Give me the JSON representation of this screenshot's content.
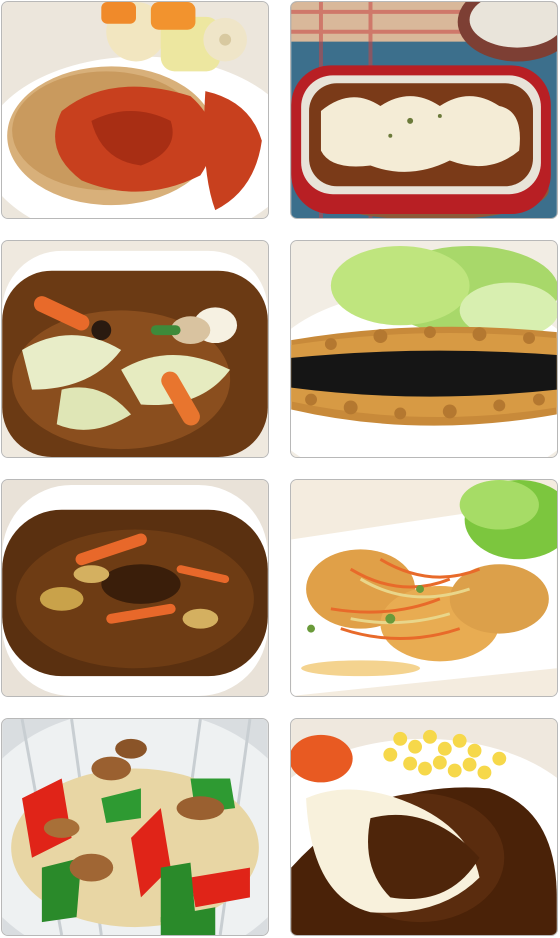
{
  "photos": [
    {
      "depicts": "chicken-tomato-sauce-icon"
    },
    {
      "depicts": "doria-gratin-icon"
    },
    {
      "depicts": "chop-suey-soup-icon"
    },
    {
      "depicts": "nori-katsu-icon"
    },
    {
      "depicts": "curry-soup-icon"
    },
    {
      "depicts": "fried-fish-nanban-icon"
    },
    {
      "depicts": "pork-vegetable-stirfry-icon"
    },
    {
      "depicts": "hamburg-steak-demiglace-icon"
    }
  ],
  "colors": {
    "tile_border": "#b8b8b8",
    "tomato_sauce": "#c8401e",
    "gratin_dish": "#b81f24",
    "brown_gravy": "#6b3a14",
    "curry": "#5a3010",
    "demiglace": "#4a2208"
  }
}
